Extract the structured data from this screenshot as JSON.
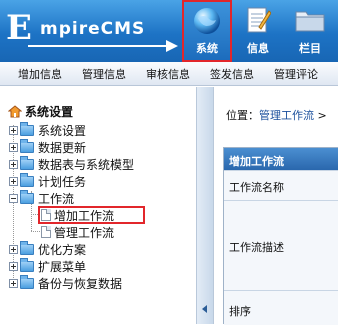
{
  "header": {
    "logo_first": "E",
    "logo_rest": "mpireCMS",
    "buttons": [
      {
        "label": "系统",
        "icon": "globe-icon",
        "active": true
      },
      {
        "label": "信息",
        "icon": "notepad-icon",
        "active": false
      },
      {
        "label": "栏目",
        "icon": "folder-icon",
        "active": false
      }
    ]
  },
  "menu": [
    "增加信息",
    "管理信息",
    "审核信息",
    "签发信息",
    "管理评论"
  ],
  "tree": {
    "root": "系统设置",
    "items": [
      {
        "label": "系统设置",
        "expanded": false
      },
      {
        "label": "数据更新",
        "expanded": false
      },
      {
        "label": "数据表与系统模型",
        "expanded": false
      },
      {
        "label": "计划任务",
        "expanded": false
      },
      {
        "label": "工作流",
        "expanded": true
      },
      {
        "label": "增加工作流",
        "child": true,
        "highlighted": true
      },
      {
        "label": "管理工作流",
        "child": true
      },
      {
        "label": "优化方案",
        "expanded": false
      },
      {
        "label": "扩展菜单",
        "expanded": false
      },
      {
        "label": "备份与恢复数据",
        "expanded": false
      }
    ]
  },
  "content": {
    "breadcrumb_prefix": "位置：",
    "breadcrumb_link": "管理工作流",
    "breadcrumb_sep": " >",
    "form_title": "增加工作流",
    "fields": [
      "工作流名称",
      "工作流描述",
      "排序"
    ]
  },
  "colors": {
    "header_blue": "#1d73c5",
    "highlight_red": "#e2262b",
    "link_blue": "#1a4f9c"
  }
}
